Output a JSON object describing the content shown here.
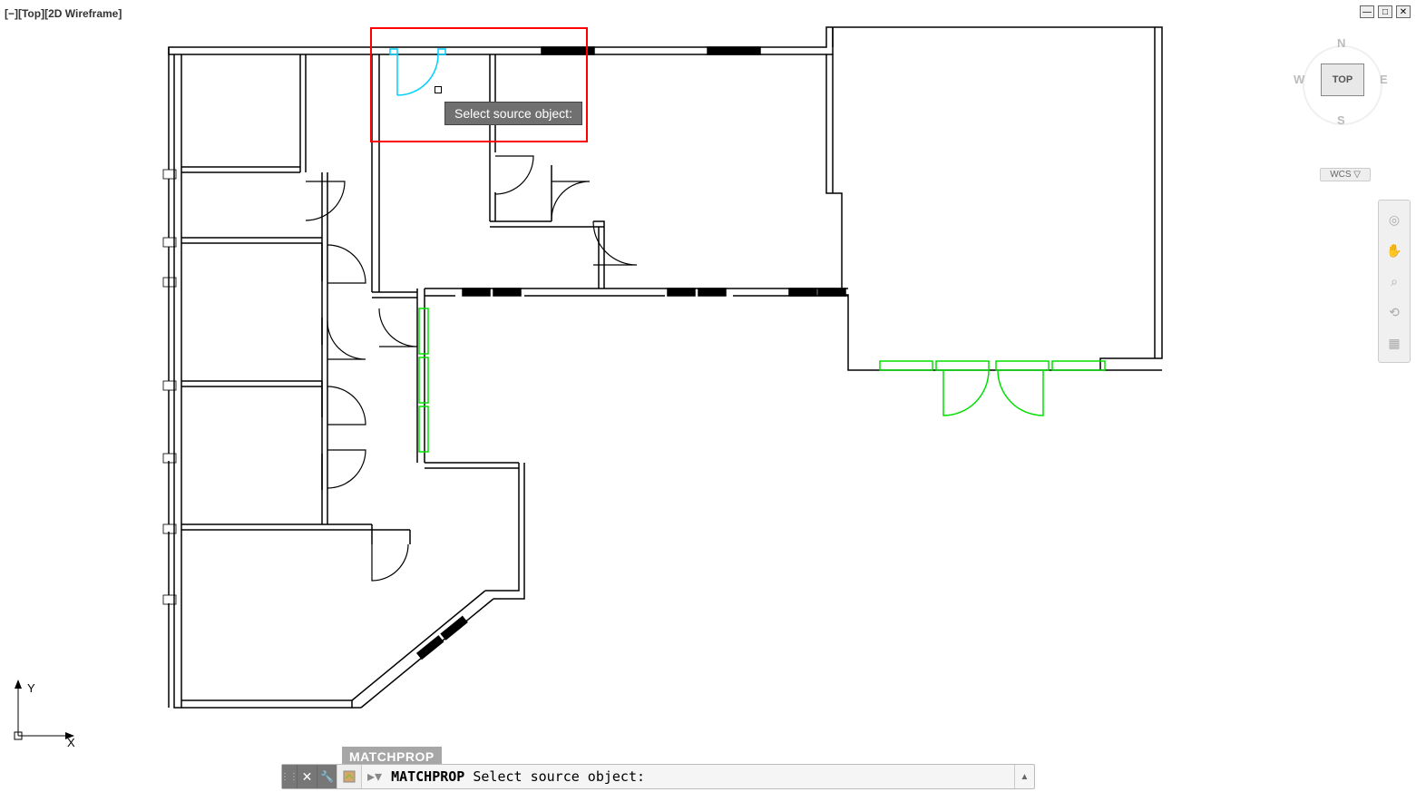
{
  "viewport": {
    "label": "[−][Top][2D Wireframe]"
  },
  "viewcube": {
    "face": "TOP",
    "n": "N",
    "s": "S",
    "e": "E",
    "w": "W"
  },
  "wcs": {
    "label": "WCS ▽"
  },
  "tooltip": {
    "text": "Select source object:"
  },
  "command": {
    "recent": "MATCHPROP",
    "name": "MATCHPROP",
    "prompt": " Select source object:"
  },
  "ucs": {
    "x": "X",
    "y": "Y"
  }
}
